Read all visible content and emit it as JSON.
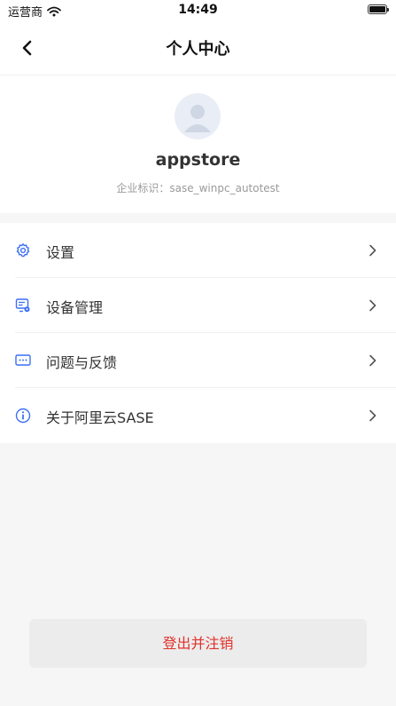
{
  "status_bar": {
    "carrier": "运营商",
    "time": "14:49"
  },
  "nav": {
    "title": "个人中心"
  },
  "profile": {
    "username": "appstore",
    "enterprise_label": "企业标识：",
    "enterprise_id": "sase_winpc_autotest"
  },
  "menu": [
    {
      "label": "设置",
      "icon": "settings-icon"
    },
    {
      "label": "设备管理",
      "icon": "device-management-icon"
    },
    {
      "label": "问题与反馈",
      "icon": "feedback-icon"
    },
    {
      "label": "关于阿里云SASE",
      "icon": "info-icon"
    }
  ],
  "logout": {
    "label": "登出并注销"
  },
  "colors": {
    "accent": "#3b6ff5",
    "danger": "#e0312a"
  }
}
